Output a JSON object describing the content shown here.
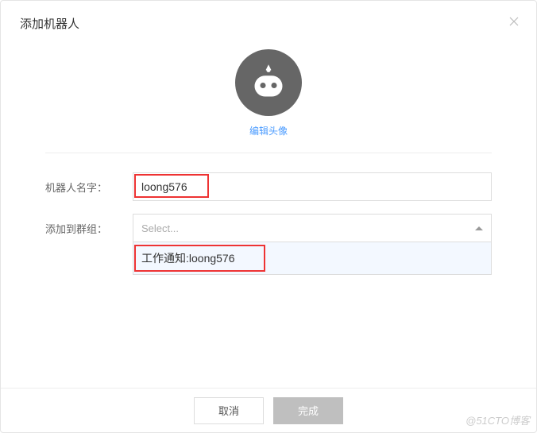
{
  "header": {
    "title": "添加机器人"
  },
  "avatar": {
    "edit_label": "编辑头像"
  },
  "form": {
    "name_label": "机器人名字：",
    "name_value": "loong576",
    "group_label": "添加到群组：",
    "group_placeholder": "Select...",
    "group_option": "工作通知:loong576"
  },
  "footer": {
    "cancel": "取消",
    "submit": "完成"
  },
  "watermark": "@51CTO博客"
}
